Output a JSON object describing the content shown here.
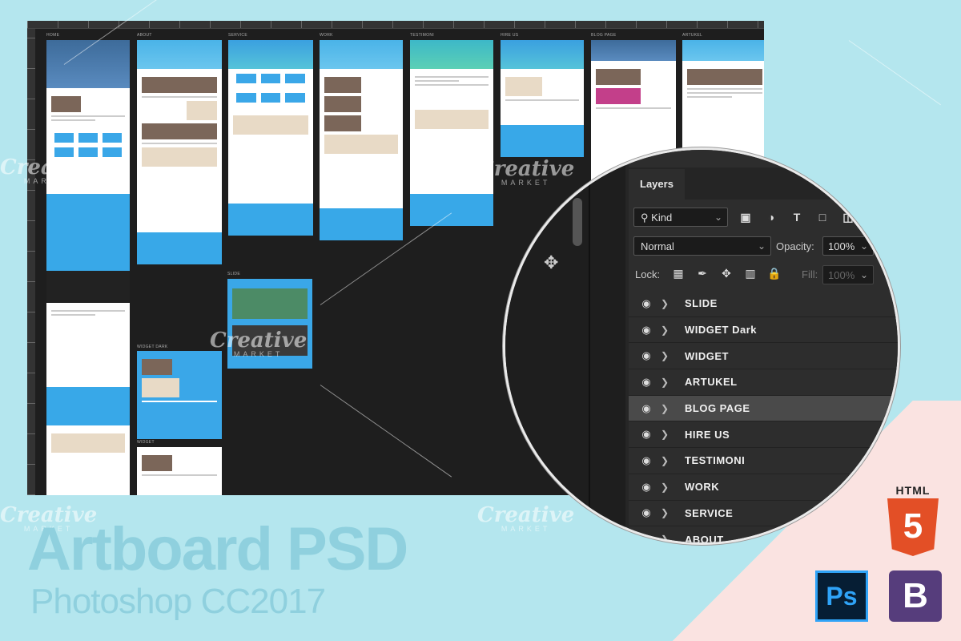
{
  "artboards": [
    {
      "label": "HOME"
    },
    {
      "label": "ABOUT"
    },
    {
      "label": "SERVICE"
    },
    {
      "label": "WORK"
    },
    {
      "label": "TESTIMONI"
    },
    {
      "label": "HIRE US"
    },
    {
      "label": "BLOG PAGE"
    },
    {
      "label": "ARTUKEL"
    },
    {
      "label": "SLIDE"
    },
    {
      "label": "WIDGET Dark"
    },
    {
      "label": "WIDGET"
    }
  ],
  "watermark": {
    "word": "Creative",
    "sub": "MARKET"
  },
  "layers_panel": {
    "tab": "Layers",
    "filter_kind": "Kind",
    "blend_mode": "Normal",
    "opacity_label": "Opacity:",
    "opacity_value": "100%",
    "lock_label": "Lock:",
    "fill_label": "Fill:",
    "fill_value": "100%",
    "filter_icons": [
      "image-icon",
      "adjustment-icon",
      "type-icon",
      "shape-icon",
      "smart-object-icon"
    ],
    "layers": [
      {
        "name": "SLIDE",
        "selected": false
      },
      {
        "name": "WIDGET Dark",
        "selected": false
      },
      {
        "name": "WIDGET",
        "selected": false
      },
      {
        "name": "ARTUKEL",
        "selected": false
      },
      {
        "name": "BLOG PAGE",
        "selected": true
      },
      {
        "name": "HIRE US",
        "selected": false
      },
      {
        "name": "TESTIMONI",
        "selected": false
      },
      {
        "name": "WORK",
        "selected": false
      },
      {
        "name": "SERVICE",
        "selected": false
      },
      {
        "name": "ABOUT",
        "selected": false
      }
    ]
  },
  "title": "Artboard PSD",
  "subtitle": "Photoshop CC2017",
  "logos": {
    "html5_label": "HTML",
    "html5_glyph": "5",
    "ps_glyph": "Ps",
    "bs_glyph": "B"
  },
  "colors": {
    "background": "#b4e6ee",
    "accent_blue": "#38a8e8",
    "ps_panel": "#2d2d2d",
    "html5": "#e34f26",
    "bootstrap": "#563d7c"
  }
}
